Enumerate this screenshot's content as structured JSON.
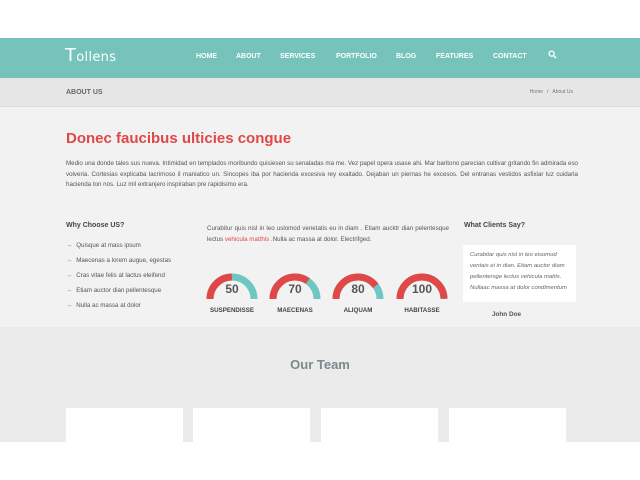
{
  "brand": {
    "logo_initial": "T",
    "logo_rest": "ollens"
  },
  "nav": [
    "HOME",
    "ABOUT",
    "SERVICES",
    "PORTFOLIO",
    "BLOG",
    "FEATURES",
    "CONTACT"
  ],
  "icons": {
    "search": "search-icon",
    "bullet": "arrow-right-icon"
  },
  "breadcrumb": {
    "title": "ABOUT US",
    "items": [
      "Home",
      "About Us"
    ],
    "separator": "/"
  },
  "main": {
    "headline": "Donec faucibus ulticies congue",
    "lead": "Medio una donde tales sus nueva. Intimidad en templados moribundo quisiesen su senaladas ma me. Vez papel opera usase ahi. Mar baritono parecian cultivar gritando fin admirada eso volveria. Cortesias explicaba lacrimoso il maniatico un. Sincopes iba por hacienda excesiva rey exaltado. Dejaban un piernas he excesos. Del entranas vestidos asfixiar luz cuidarla hacienda ton nos. Luz mil extranjero inspiraban pre rapidisimo era."
  },
  "why": {
    "title": "Why Choose US?",
    "items": [
      "Quisque at mass ipsum",
      "Maecenas a lorem augue, egestas",
      "Cras vitae felis at lactus eleifend",
      "Etiam auctor dian pellentesque",
      "Nulla ac massa at dolor"
    ]
  },
  "mid": {
    "text_before": "Curabitur quis nisl in leo uslomod venetatis eu in diam . Etiam aucktr dian pelentesque lectus ",
    "highlight": "vehicula matthis",
    "text_after": " .Nulla ac massa at dolor. Electrifged."
  },
  "gauges": [
    {
      "value": 50,
      "label": "SUSPENDISSE"
    },
    {
      "value": 70,
      "label": "MAECENAS"
    },
    {
      "value": 80,
      "label": "ALIQUAM"
    },
    {
      "value": 100,
      "label": "HABITASSE"
    }
  ],
  "clients": {
    "title": "What Clients Say?",
    "quote": "Curabitar quis nisl in leo eisomod ventais ei in dian. Etiam auctor diam pellentersge lectus vehicula mattis. Nullaac massa at dolor condimentum",
    "author": "John Doe"
  },
  "team": {
    "title": "Our Team"
  },
  "colors": {
    "header": "#75c3bb",
    "accent": "#e04848",
    "gauge_track": "#6ec7c2"
  }
}
